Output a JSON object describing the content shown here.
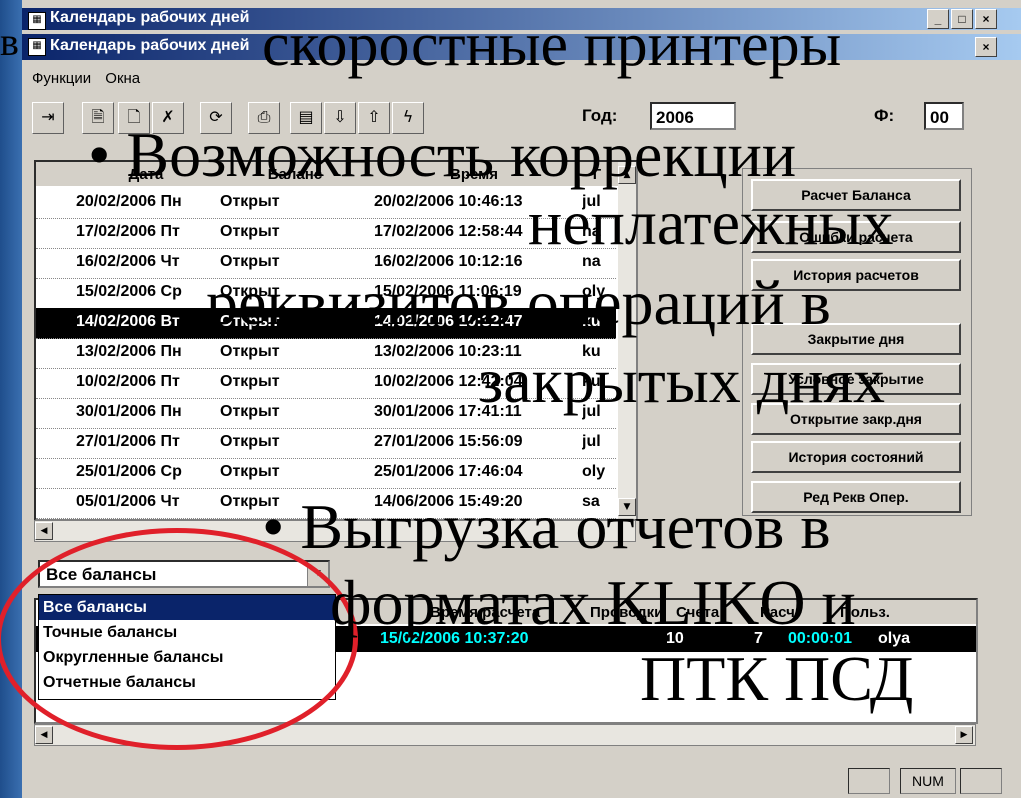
{
  "window": {
    "back_title": "Календарь рабочих дней",
    "title": "Календарь рабочих дней",
    "btn_min": "_",
    "btn_max": "□",
    "btn_close": "×"
  },
  "menu": {
    "item1": "Функции",
    "item2": "Окна"
  },
  "toolbar": {
    "year_label": "Год:",
    "year_value": "2006",
    "f_label": "Ф:",
    "f_value": "00",
    "icons": [
      "exit-icon",
      "document-icon",
      "new-document-icon",
      "delete-document-icon",
      "refresh-icon",
      "print-icon",
      "table-icon",
      "export-icon",
      "import-icon",
      "lightning-icon"
    ]
  },
  "grid": {
    "columns": [
      "Дата",
      "Баланс",
      "Время",
      "Г"
    ],
    "rows": [
      {
        "date": "20/02/2006 Пн",
        "balance": "Открыт",
        "time": "20/02/2006 10:46:13",
        "user": "jul"
      },
      {
        "date": "17/02/2006 Пт",
        "balance": "Открыт",
        "time": "17/02/2006 12:58:44",
        "user": "na"
      },
      {
        "date": "16/02/2006 Чт",
        "balance": "Открыт",
        "time": "16/02/2006 10:12:16",
        "user": "na"
      },
      {
        "date": "15/02/2006 Ср",
        "balance": "Открыт",
        "time": "15/02/2006 11:06:19",
        "user": "oly"
      },
      {
        "date": "14/02/2006 Вт",
        "balance": "Открыт",
        "time": "14/02/2006 10:32:47",
        "user": "ku"
      },
      {
        "date": "13/02/2006 Пн",
        "balance": "Открыт",
        "time": "13/02/2006 10:23:11",
        "user": "ku"
      },
      {
        "date": "10/02/2006 Пт",
        "balance": "Открыт",
        "time": "10/02/2006 12:42:04",
        "user": "ku"
      },
      {
        "date": "30/01/2006 Пн",
        "balance": "Открыт",
        "time": "30/01/2006 17:41:11",
        "user": "jul"
      },
      {
        "date": "27/01/2006 Пт",
        "balance": "Открыт",
        "time": "27/01/2006 15:56:09",
        "user": "jul"
      },
      {
        "date": "25/01/2006 Ср",
        "balance": "Открыт",
        "time": "25/01/2006 17:46:04",
        "user": "oly"
      },
      {
        "date": "05/01/2006 Чт",
        "balance": "Открыт",
        "time": "14/06/2006 15:49:20",
        "user": "sa"
      }
    ]
  },
  "buttons": [
    "Расчет Баланса",
    "Ошибки расчета",
    "История расчетов",
    "Закрытие дня",
    "Условное закрытие",
    "Открытие закр.дня",
    "История состояний",
    "Ред Рекв Опер."
  ],
  "combo": {
    "value": "Все балансы"
  },
  "dropdown": [
    "Все балансы",
    "Точные балансы",
    "Округленные балансы",
    "Отчетные балансы"
  ],
  "grid2": {
    "columns": [
      "Время расчета",
      "Проводки",
      "Счета",
      "Расч",
      "Польз."
    ],
    "row": {
      "time": "15/02/2006 10:37:20",
      "postings": "10",
      "accounts": "7",
      "calc": "00:00:01",
      "user": "olya"
    }
  },
  "status": {
    "num": "NUM"
  },
  "slide": {
    "line0": "в",
    "line1": "скоростные принтеры",
    "bullet1_l1": "• Возможность коррекции",
    "bullet1_l2": "неплатежных",
    "bullet1_l3": "реквизитов операций в",
    "bullet1_l4": "закрытых днях",
    "bullet2_l1": "• Выгрузка отчетов в",
    "bullet2_l2": "форматах KLIKO и",
    "bullet2_l3": "ПТК ПСД"
  }
}
